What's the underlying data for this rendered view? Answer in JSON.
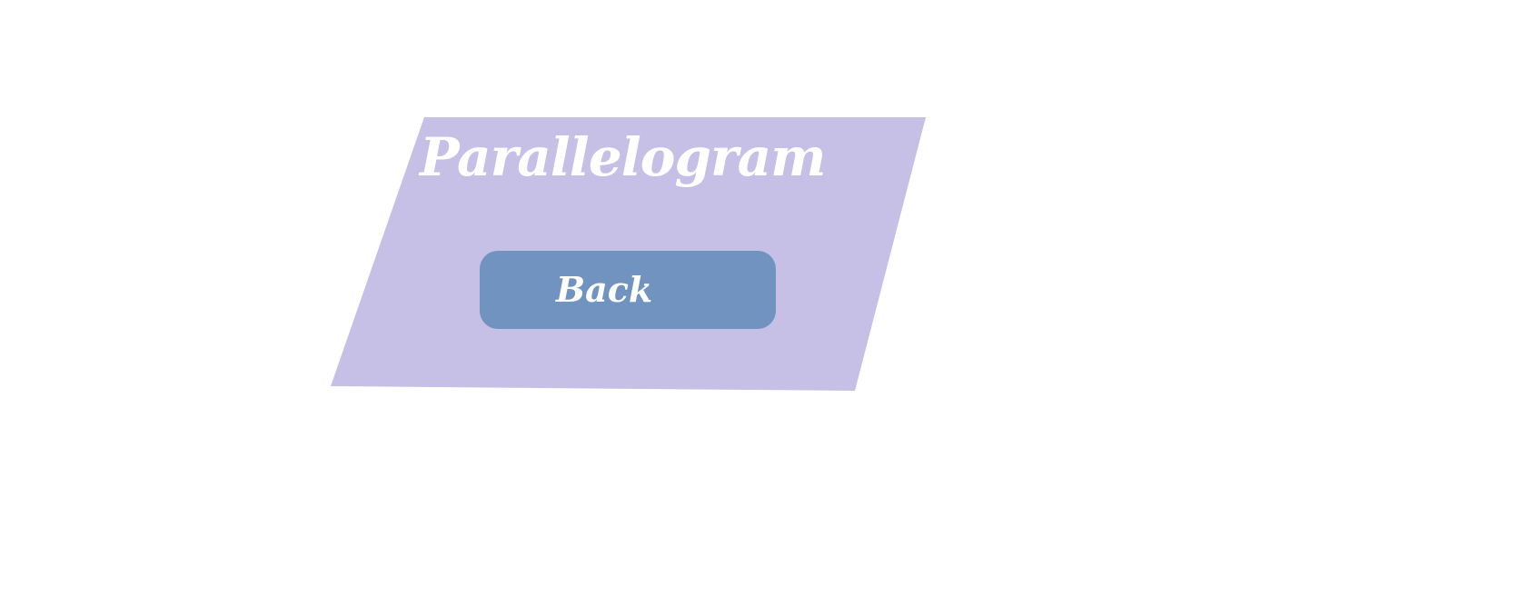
{
  "colors": {
    "background": "#ffffff",
    "shape_fill": "#c6bfe6",
    "button_fill": "#7093bf",
    "text": "#ffffff"
  },
  "shape": {
    "title": "Parallelogram"
  },
  "back_button": {
    "label": "Back"
  }
}
